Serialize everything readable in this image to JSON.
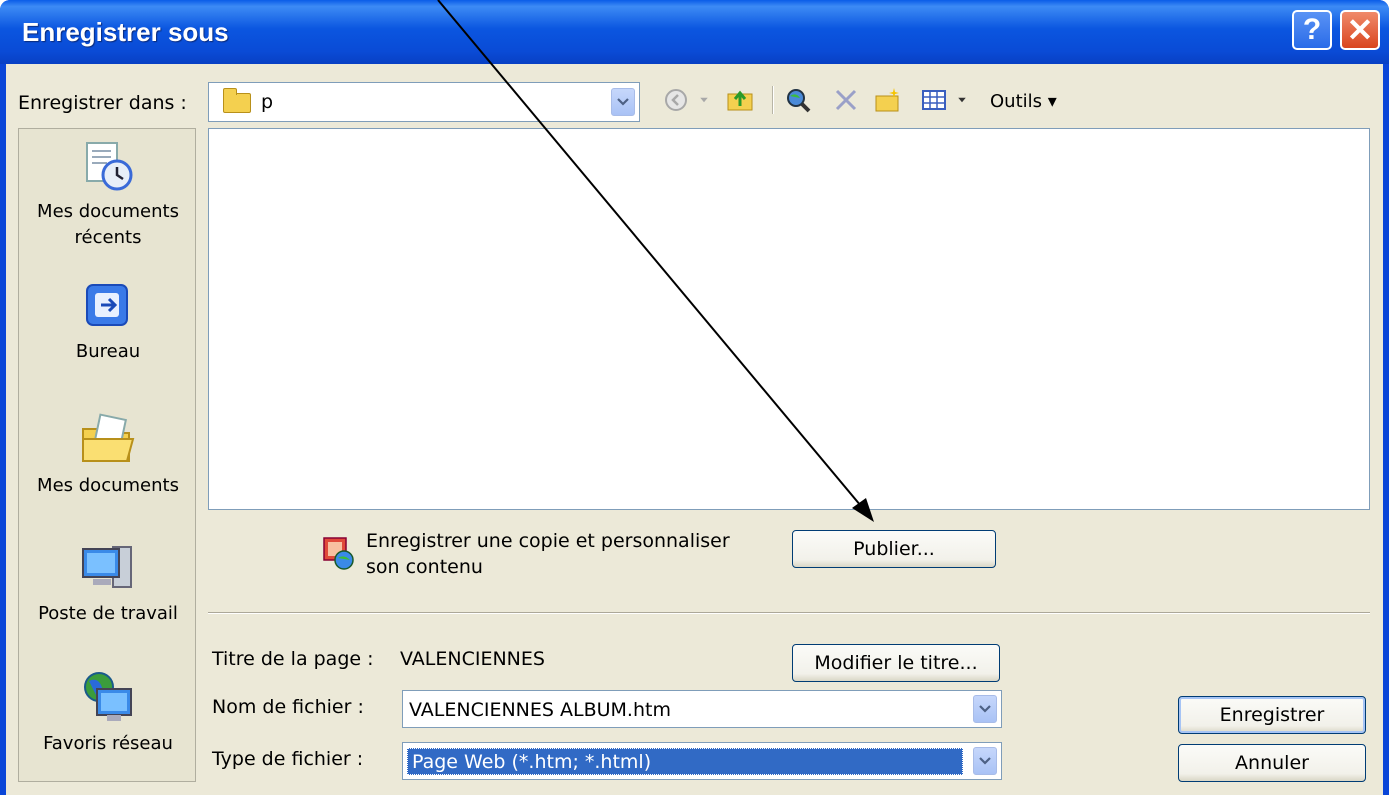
{
  "window": {
    "title": "Enregistrer sous",
    "help_label": "?",
    "close_label": "✕"
  },
  "toolbar": {
    "save_in_label": "Enregistrer dans :",
    "folder_name": "p",
    "tools_label": "Outils ▾",
    "icons": [
      "back-icon",
      "up-folder-icon",
      "search-web-icon",
      "delete-icon",
      "new-folder-icon",
      "views-icon"
    ]
  },
  "places": [
    {
      "label": "Mes documents récents",
      "icon": "recent-documents-icon"
    },
    {
      "label": "Bureau",
      "icon": "desktop-icon"
    },
    {
      "label": "Mes documents",
      "icon": "my-documents-icon"
    },
    {
      "label": "Poste de travail",
      "icon": "my-computer-icon"
    },
    {
      "label": "Favoris réseau",
      "icon": "network-places-icon"
    }
  ],
  "publish": {
    "text_line1": "Enregistrer une copie et personnaliser",
    "text_line2": "son contenu",
    "button_label": "Publier..."
  },
  "form": {
    "page_title_label": "Titre de la page :",
    "page_title_value": "VALENCIENNES",
    "modify_title_button": "Modifier le titre...",
    "filename_label": "Nom de fichier :",
    "filename_value": "VALENCIENNES ALBUM.htm",
    "filetype_label": "Type de fichier :",
    "filetype_value": "Page Web (*.htm; *.html)"
  },
  "actions": {
    "save_label": "Enregistrer",
    "cancel_label": "Annuler"
  },
  "colors": {
    "title_bar": "#0a4bd6",
    "dialog_bg": "#ece9d8",
    "selection": "#316ac5",
    "annotation_arrow": "#000000"
  }
}
